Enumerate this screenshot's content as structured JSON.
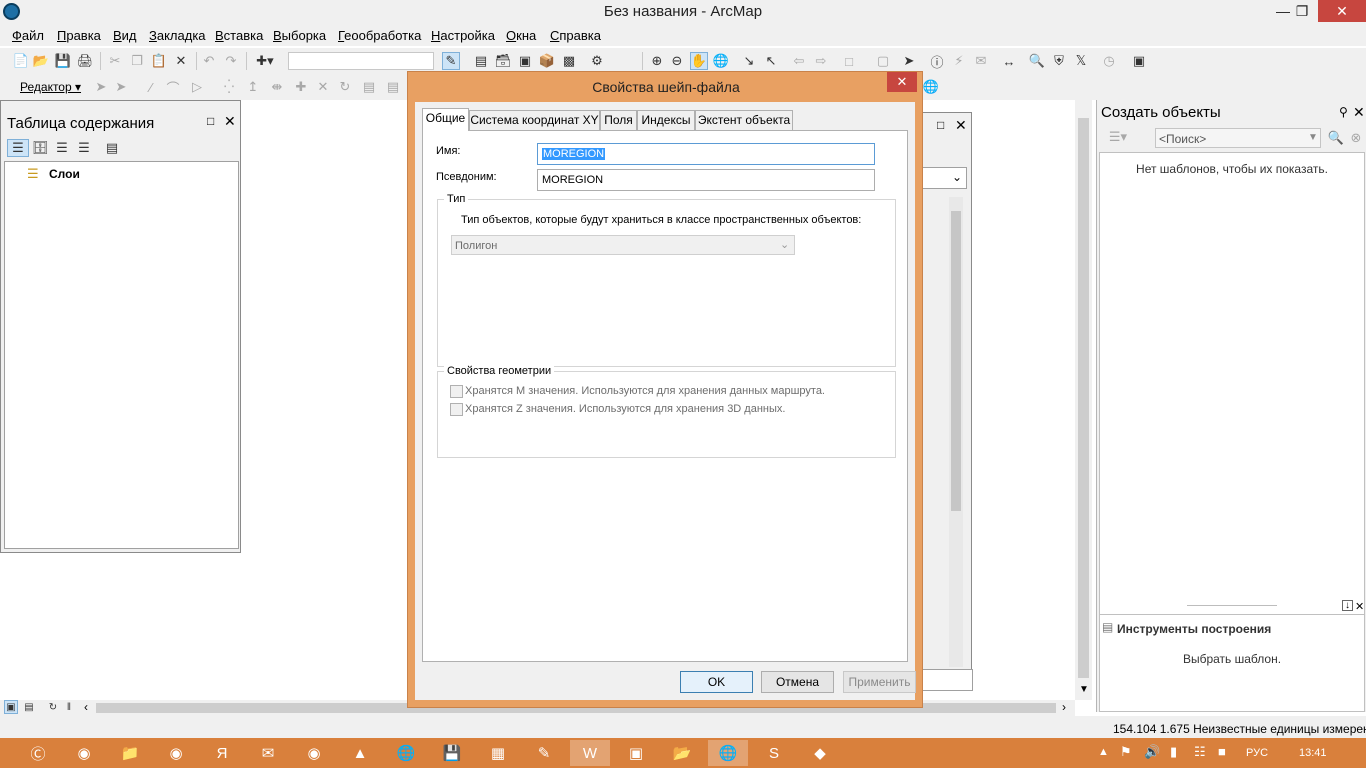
{
  "window": {
    "title": "Без названия - ArcMap"
  },
  "menu": [
    "Файл",
    "Правка",
    "Вид",
    "Закладка",
    "Вставка",
    "Выборка",
    "Геообработка",
    "Настройка",
    "Окна",
    "Справка"
  ],
  "editor_toolbar": {
    "label": "Редактор ▾"
  },
  "toc": {
    "title": "Таблица содержания",
    "root_label": "Слои"
  },
  "create_features": {
    "title": "Создать объекты",
    "search_placeholder": "<Поиск>",
    "empty_message": "Нет шаблонов, чтобы их показать.",
    "tools_title": "Инструменты построения",
    "tools_message": "Выбрать шаблон."
  },
  "statusbar": {
    "coords": "154.104  1.675 Неизвестные единицы измерен"
  },
  "dialog": {
    "title": "Свойства шейп-файла",
    "tabs": [
      "Общие",
      "Система координат XY",
      "Поля",
      "Индексы",
      "Экстент объекта"
    ],
    "name_label": "Имя:",
    "name_value": "MOREGION",
    "alias_label": "Псевдоним:",
    "alias_value": "MOREGION",
    "type_group": "Тип",
    "type_desc": "Тип объектов, которые будут храниться в классе пространственных объектов:",
    "type_value": "Полигон",
    "geom_group": "Свойства геометрии",
    "m_values": "Хранятся М значения. Используются для хранения данных маршрута.",
    "z_values": "Хранятся Z значения. Используются для хранения 3D данных.",
    "ok": "OK",
    "cancel": "Отмена",
    "apply": "Применить"
  },
  "taskbar": {
    "language": "РУС",
    "time": "13:41"
  },
  "colors": {
    "dialog_frame": "#e8a062",
    "taskbar": "#d9803c",
    "close_red": "#c7463f"
  }
}
